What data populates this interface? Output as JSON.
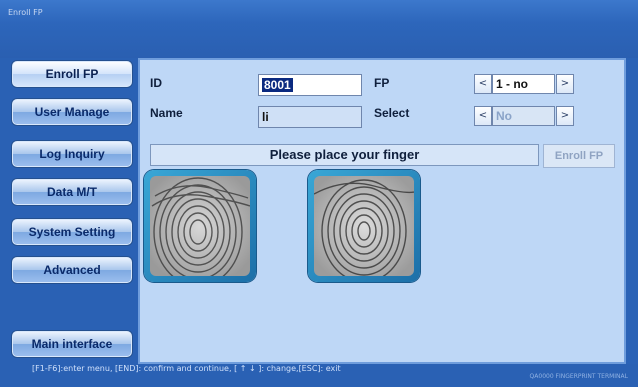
{
  "window": {
    "title": "Enroll FP"
  },
  "sidebar": {
    "items": [
      {
        "label": "Enroll FP",
        "active": true
      },
      {
        "label": "User Manage"
      },
      {
        "label": "Log Inquiry"
      },
      {
        "label": "Data M/T"
      },
      {
        "label": "System Setting"
      },
      {
        "label": "Advanced"
      }
    ],
    "main_interface": "Main interface"
  },
  "form": {
    "id_label": "ID",
    "id_value": "8001",
    "name_label": "Name",
    "name_value": "li",
    "fp_label": "FP",
    "fp_value": "1 - no",
    "select_label": "Select",
    "select_value": "No",
    "prev_symbol": "<",
    "next_symbol": ">"
  },
  "status_message": "Please place your finger",
  "enroll_button": "Enroll FP",
  "footer": {
    "help": "[F1-F6]:enter menu, [END]: confirm and continue, [ ↑ ↓ ]: change,[ESC]: exit",
    "brand": "QA0000 FINGERPRINT TERMINAL"
  },
  "colors": {
    "accent": "#2a61b4",
    "panel": "#bed7f6"
  }
}
